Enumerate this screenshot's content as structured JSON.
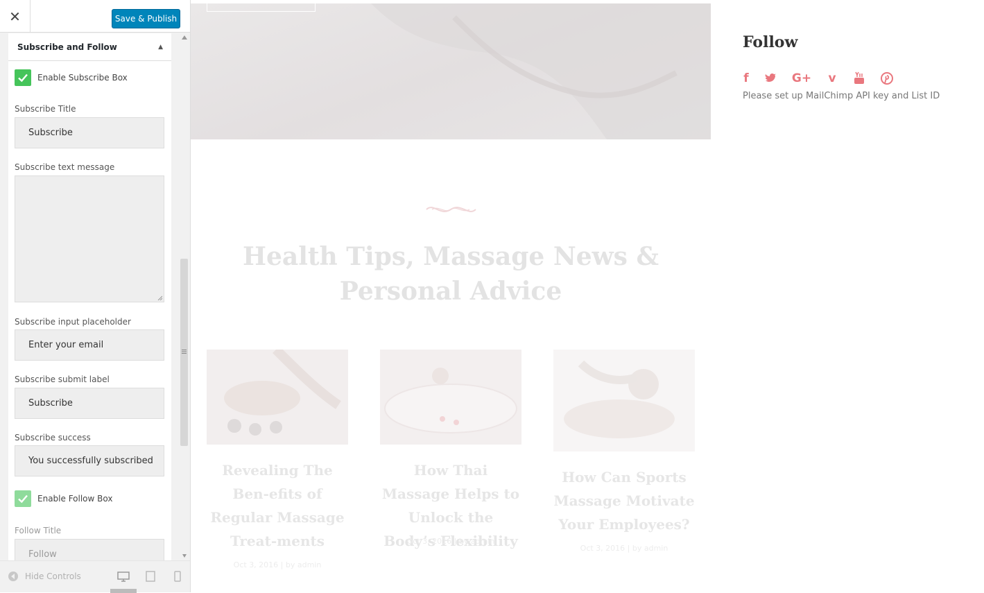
{
  "customizer": {
    "save_label": "Save & Publish",
    "section_title": "Subscribe and Follow",
    "enable_subscribe_label": "Enable Subscribe Box",
    "subscribe_title_label": "Subscribe Title",
    "subscribe_title_value": "Subscribe",
    "subscribe_text_label": "Subscribe text message",
    "subscribe_text_value": "",
    "input_placeholder_label": "Subscribe input placeholder",
    "input_placeholder_value": "Enter your email",
    "submit_label_label": "Subscribe submit label",
    "submit_label_value": "Subscribe",
    "success_label": "Subscribe success",
    "success_value": "You successfully subscribed",
    "enable_follow_label": "Enable Follow Box",
    "follow_title_label": "Follow Title",
    "follow_title_value": "Follow",
    "hide_controls": "Hide Controls",
    "accent_color": "#0085ba",
    "checkbox_color": "#45c45a"
  },
  "preview": {
    "blog_title": "Health Tips, Massage News & Personal Advice",
    "posts": [
      {
        "title": "Revealing The Ben-efits of Regular Massage Treat-ments",
        "meta": "Oct 3, 2016  |  by admin"
      },
      {
        "title": "How Thai Massage Helps to Unlock the Body’s Flexibility",
        "meta": "Oct 3, 2016  |  by admin"
      },
      {
        "title": "How Can Sports Massage Motivate Your Employees?",
        "meta": "Oct 3, 2016  |  by admin"
      }
    ],
    "follow_title": "Follow",
    "social_icons": [
      "facebook-icon",
      "twitter-icon",
      "google-plus-icon",
      "vimeo-icon",
      "youtube-icon",
      "pinterest-icon"
    ],
    "mailchimp_note": "Please set up MailChimp API key and List ID",
    "social_color": "#e9777e"
  }
}
